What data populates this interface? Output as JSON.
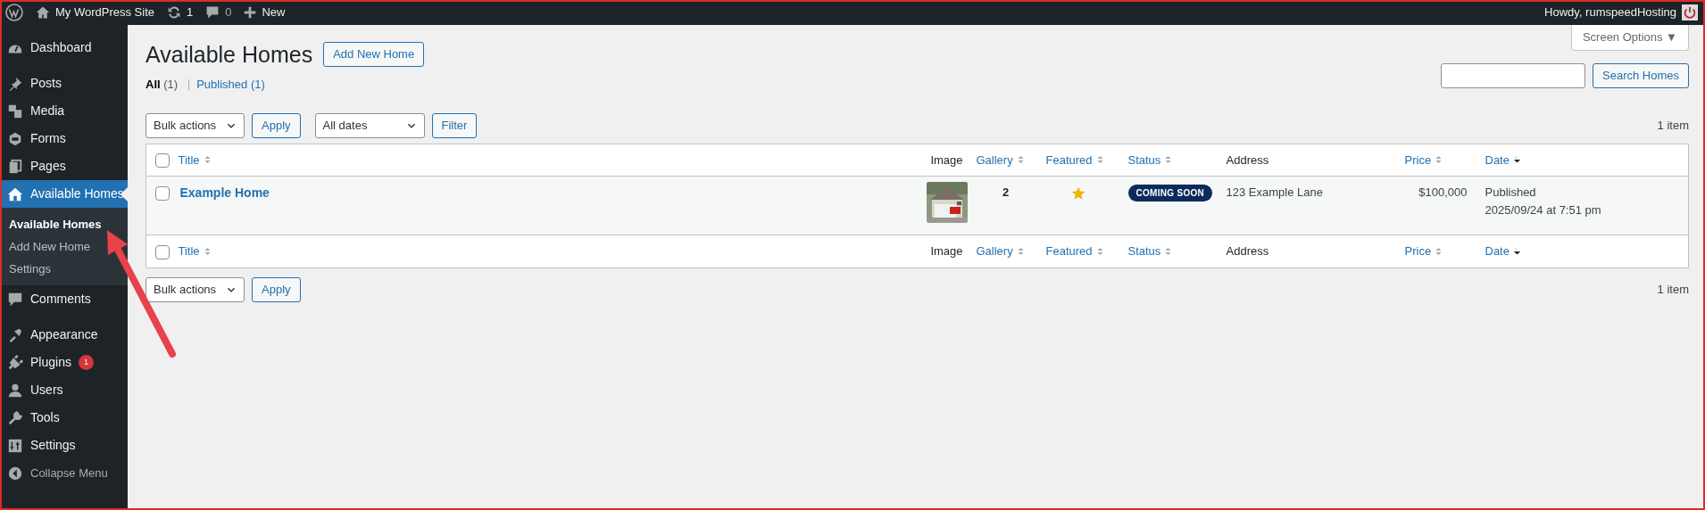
{
  "admin_bar": {
    "site_name": "My WordPress Site",
    "updates_count": "1",
    "comments_count": "0",
    "new_label": "New",
    "greeting": "Howdy, rumspeedHosting"
  },
  "sidebar": {
    "items": [
      {
        "kind": "item",
        "label": "Dashboard",
        "selected": false
      },
      {
        "kind": "separator"
      },
      {
        "kind": "item",
        "label": "Posts",
        "selected": false
      },
      {
        "kind": "item",
        "label": "Media",
        "selected": false
      },
      {
        "kind": "item",
        "label": "Forms",
        "selected": false
      },
      {
        "kind": "item",
        "label": "Pages",
        "selected": false
      },
      {
        "kind": "item",
        "label": "Available Homes",
        "selected": true,
        "children": [
          {
            "label": "Available Homes",
            "selected": true
          },
          {
            "label": "Add New Home",
            "selected": false
          },
          {
            "label": "Settings",
            "selected": false
          }
        ]
      },
      {
        "kind": "item",
        "label": "Comments",
        "selected": false
      },
      {
        "kind": "separator"
      },
      {
        "kind": "item",
        "label": "Appearance",
        "selected": false
      },
      {
        "kind": "item",
        "label": "Plugins",
        "selected": false,
        "badge": "1"
      },
      {
        "kind": "item",
        "label": "Users",
        "selected": false
      },
      {
        "kind": "item",
        "label": "Tools",
        "selected": false
      },
      {
        "kind": "item",
        "label": "Settings",
        "selected": false
      },
      {
        "kind": "collapse",
        "label": "Collapse Menu",
        "selected": false
      }
    ]
  },
  "page": {
    "title": "Available Homes",
    "add_button": "Add New Home",
    "screen_options": "Screen Options ▼",
    "views": [
      {
        "label": "All",
        "count": "(1)",
        "selected": true
      },
      {
        "label": "Published",
        "count": "(1)",
        "selected": false
      }
    ],
    "search_button": "Search Homes",
    "top_toolbar": {
      "bulk_actions": "Bulk actions",
      "apply": "Apply",
      "date_filter": "All dates",
      "filter": "Filter",
      "item_count": "1 item"
    },
    "bottom_toolbar": {
      "bulk_actions": "Bulk actions",
      "apply": "Apply",
      "item_count": "1 item"
    }
  },
  "table": {
    "columns": [
      {
        "label": "Title",
        "kind": "sortable"
      },
      {
        "label": "Image",
        "kind": "plain"
      },
      {
        "label": "Gallery",
        "kind": "sortable"
      },
      {
        "label": "Featured",
        "kind": "sortable"
      },
      {
        "label": "Status",
        "kind": "sortable"
      },
      {
        "label": "Address",
        "kind": "plain"
      },
      {
        "label": "Price",
        "kind": "sortable"
      },
      {
        "label": "Date",
        "kind": "sorted"
      }
    ],
    "footer_columns": [
      {
        "label": "Title",
        "kind": "sortable"
      },
      {
        "label": "Image",
        "kind": "plain"
      },
      {
        "label": "Gallery",
        "kind": "sortable"
      },
      {
        "label": "Featured",
        "kind": "sortable"
      },
      {
        "label": "Status",
        "kind": "sortable"
      },
      {
        "label": "Address",
        "kind": "plain"
      },
      {
        "label": "Price",
        "kind": "sortable"
      },
      {
        "label": "Date",
        "kind": "sorted"
      }
    ],
    "rows": [
      {
        "checked": false,
        "title": "Example Home",
        "gallery": "2",
        "featured": true,
        "status": "COMING SOON",
        "address": "123 Example Lane",
        "price": "$100,000",
        "date_status": "Published",
        "date": "2025/09/24 at 7:51 pm"
      }
    ],
    "select_all_checked": false
  }
}
